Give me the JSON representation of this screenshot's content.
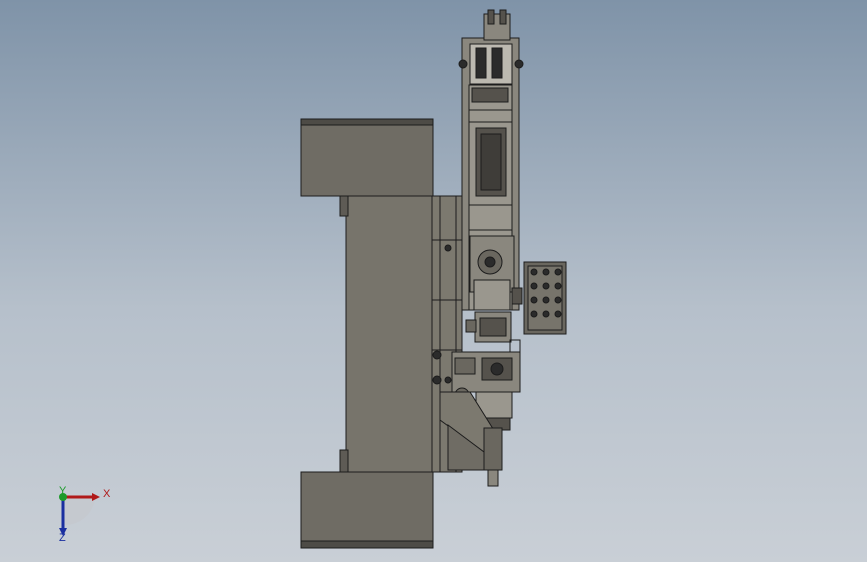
{
  "viewport": {
    "background_top": "#7f93a8",
    "background_bottom": "#c9cfd6",
    "part_fill": "#737067",
    "part_fill_light": "#8a877e",
    "part_edge": "#1c1c1c"
  },
  "triad": {
    "x_label": "X",
    "y_label": "Y",
    "z_label": "Z",
    "x_color": "#b01919",
    "y_color": "#1c9a2a",
    "z_color": "#1a2fa0"
  }
}
